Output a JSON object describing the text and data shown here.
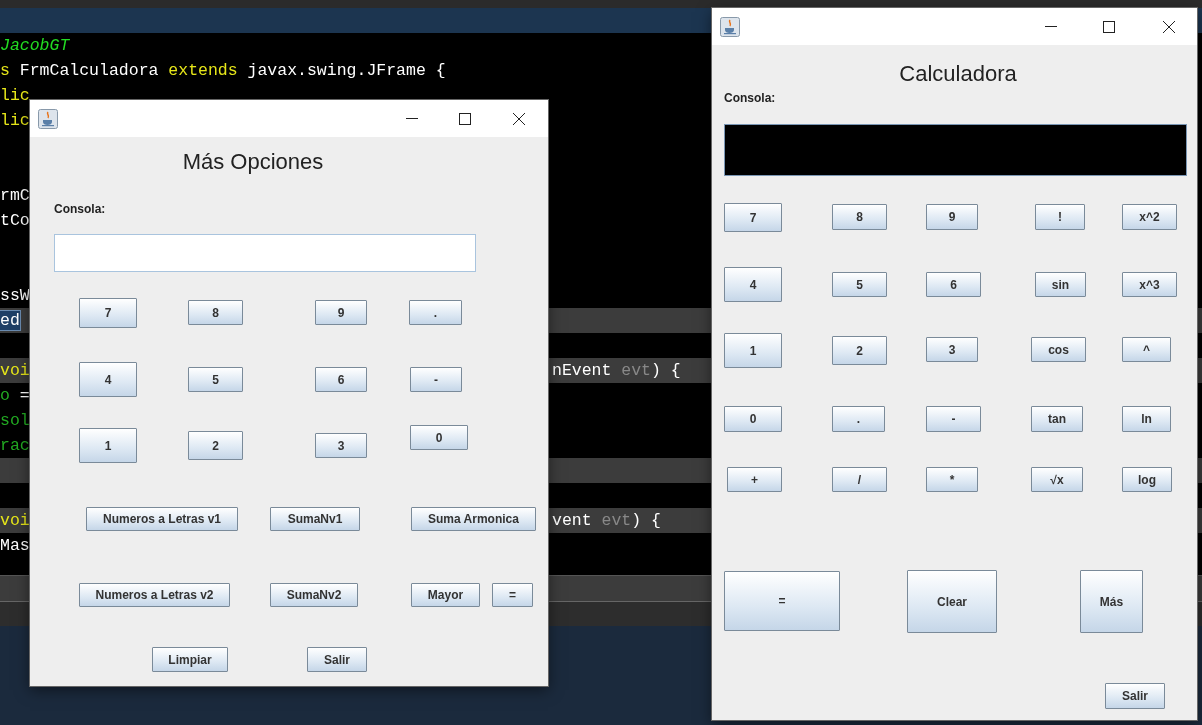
{
  "editor": {
    "lines": [
      {
        "band": false,
        "left": [
          {
            "kind": "comment",
            "text": "JacobGT"
          }
        ]
      },
      {
        "band": false,
        "left": [
          {
            "kind": "keyword",
            "text": "s"
          },
          {
            "kind": "plain",
            "text": " FrmCalculadora "
          },
          {
            "kind": "keyword",
            "text": "extends"
          },
          {
            "kind": "plain",
            "text": " javax.swing.JFrame {"
          }
        ]
      },
      {
        "band": false,
        "left": [
          {
            "kind": "keyword",
            "text": "lic"
          }
        ]
      },
      {
        "band": false,
        "left": [
          {
            "kind": "keyword",
            "text": "lic"
          }
        ]
      },
      {
        "band": false,
        "left": [
          {
            "kind": "plain",
            "text": "rmC"
          }
        ]
      },
      {
        "band": false,
        "left": [
          {
            "kind": "plain",
            "text": "tCo"
          }
        ]
      },
      {
        "band": false,
        "left": [
          {
            "kind": "plain",
            "text": "ssW"
          }
        ]
      },
      {
        "band": true,
        "left": [
          {
            "kind": "selection",
            "text": "ed"
          }
        ]
      },
      {
        "band": false
      },
      {
        "band": true,
        "left": [
          {
            "kind": "keyword",
            "text": "voi"
          }
        ],
        "right": [
          {
            "kind": "plain",
            "text": "nEvent "
          },
          {
            "kind": "dim",
            "text": "evt"
          },
          {
            "kind": "plain",
            "text": ") {"
          }
        ]
      },
      {
        "band": false,
        "left": [
          {
            "kind": "field",
            "text": "o"
          },
          {
            "kind": "plain",
            "text": " ="
          }
        ]
      },
      {
        "band": false,
        "left": [
          {
            "kind": "field",
            "text": "sol"
          }
        ]
      },
      {
        "band": false,
        "left": [
          {
            "kind": "field",
            "text": "rac"
          }
        ]
      },
      {
        "band": true
      },
      {
        "band": false
      },
      {
        "band": true,
        "left": [
          {
            "kind": "keyword",
            "text": "voi"
          }
        ],
        "right": [
          {
            "kind": "plain",
            "text": "vent "
          },
          {
            "kind": "dim",
            "text": "evt"
          },
          {
            "kind": "plain",
            "text": ") {"
          }
        ]
      },
      {
        "band": false,
        "left": [
          {
            "kind": "plain",
            "text": "Mas"
          }
        ]
      }
    ]
  },
  "windows": [
    {
      "heading": "Calculadora",
      "console_label": "Consola:",
      "console": {
        "kind": "dark"
      },
      "buttons": [
        "7",
        "8",
        "9",
        "!",
        "x^2",
        "4",
        "5",
        "6",
        "sin",
        "x^3",
        "1",
        "2",
        "3",
        "cos",
        "^",
        "0",
        ".",
        "-",
        "tan",
        "ln",
        "+",
        "/",
        "*",
        "√x",
        "log",
        "=",
        "Clear",
        "Más",
        "Salir"
      ]
    },
    {
      "heading": "Más Opciones",
      "console_label": "Consola:",
      "console": {
        "kind": "light"
      },
      "buttons": [
        "7",
        "8",
        "9",
        ".",
        "4",
        "5",
        "6",
        "-",
        "1",
        "2",
        "3",
        "0",
        "Numeros a Letras v1",
        "SumaNv1",
        "Suma Armonica",
        "Numeros a Letras v2",
        "SumaNv2",
        "Mayor",
        "=",
        "Limpiar",
        "Salir"
      ]
    }
  ]
}
